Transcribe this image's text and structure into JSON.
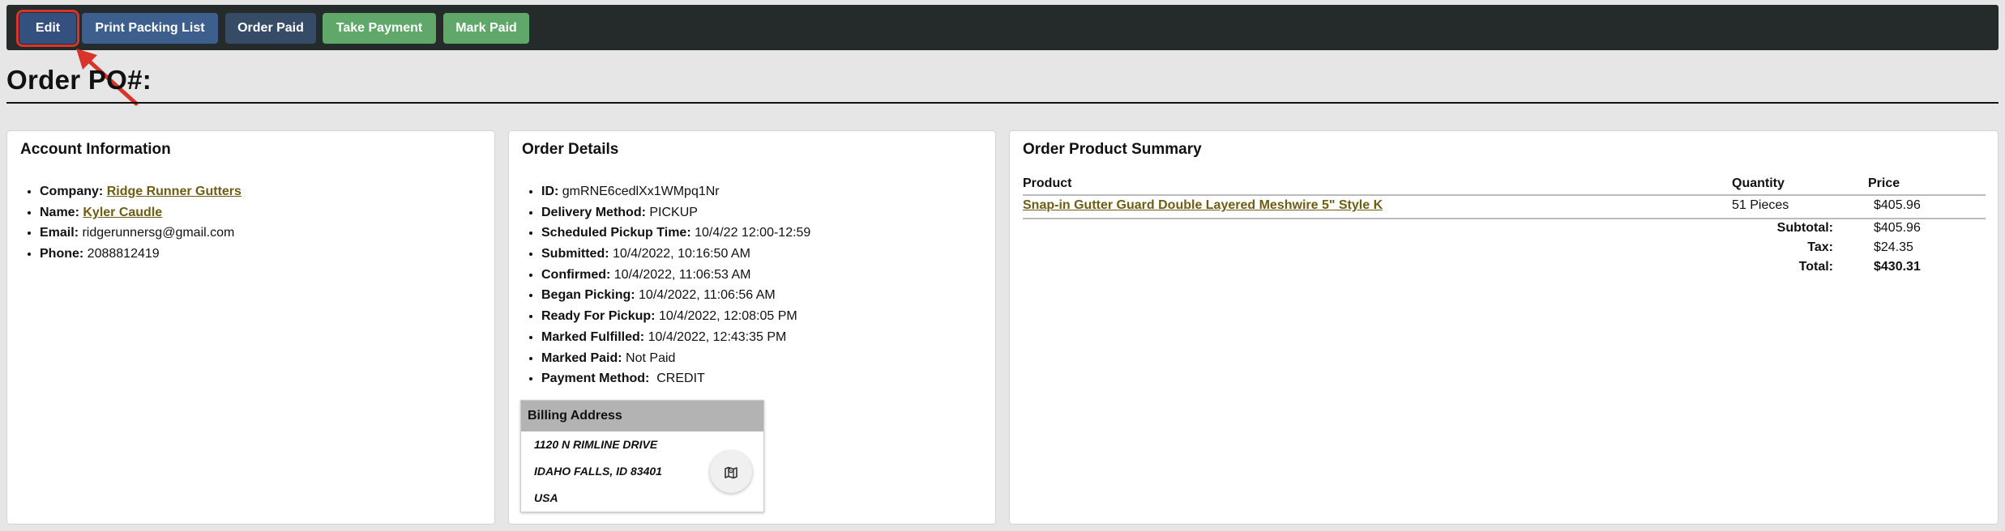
{
  "toolbar": {
    "edit": "Edit",
    "print_packing_list": "Print Packing List",
    "order_paid": "Order Paid",
    "take_payment": "Take Payment",
    "mark_paid": "Mark Paid"
  },
  "page_title": "Order PO#:",
  "account": {
    "heading": "Account Information",
    "company_label": "Company:",
    "company": "Ridge Runner Gutters",
    "name_label": "Name:",
    "name": "Kyler Caudle",
    "email_label": "Email:",
    "email": "ridgerunnersg@gmail.com",
    "phone_label": "Phone:",
    "phone": "2088812419"
  },
  "order": {
    "heading": "Order Details",
    "fields": [
      {
        "label": "ID:",
        "value": "gmRNE6cedlXx1WMpq1Nr"
      },
      {
        "label": "Delivery Method:",
        "value": "PICKUP"
      },
      {
        "label": "Scheduled Pickup Time:",
        "value": "10/4/22 12:00-12:59"
      },
      {
        "label": "Submitted:",
        "value": "10/4/2022, 10:16:50 AM"
      },
      {
        "label": "Confirmed:",
        "value": "10/4/2022, 11:06:53 AM"
      },
      {
        "label": "Began Picking:",
        "value": "10/4/2022, 11:06:56 AM"
      },
      {
        "label": "Ready For Pickup:",
        "value": "10/4/2022, 12:08:05 PM"
      },
      {
        "label": "Marked Fulfilled:",
        "value": "10/4/2022, 12:43:35 PM"
      },
      {
        "label": "Marked Paid:",
        "value": "Not Paid"
      },
      {
        "label": "Payment Method:",
        "value": "CREDIT"
      }
    ],
    "billing": {
      "heading": "Billing Address",
      "line1": "1120 N RIMLINE DRIVE",
      "line2": "IDAHO FALLS, ID 83401",
      "line3": "USA"
    }
  },
  "summary": {
    "heading": "Order Product Summary",
    "columns": {
      "product": "Product",
      "quantity": "Quantity",
      "price": "Price"
    },
    "rows": [
      {
        "product": "Snap-in Gutter Guard Double Layered Meshwire 5\" Style K",
        "quantity": "51 Pieces",
        "price": "$405.96"
      }
    ],
    "subtotal_label": "Subtotal:",
    "subtotal": "$405.96",
    "tax_label": "Tax:",
    "tax": "$24.35",
    "total_label": "Total:",
    "total": "$430.31"
  },
  "colors": {
    "toolbar_bg": "#252a2a",
    "link": "#6e5d14",
    "success": "#5fa86a",
    "primary": "#3d5f8e",
    "annotation_red": "#d9342b"
  }
}
